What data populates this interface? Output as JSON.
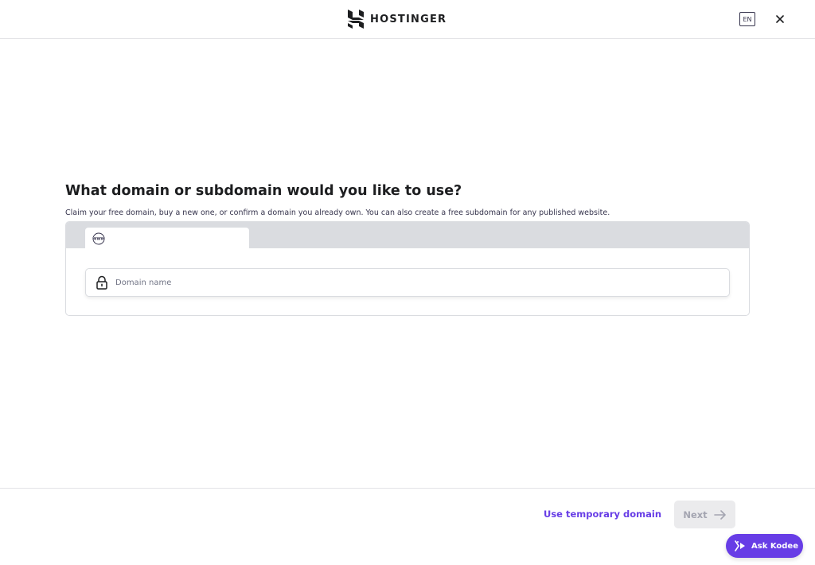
{
  "header": {
    "brand": "HOSTINGER",
    "language": "EN",
    "close_icon": "close-icon"
  },
  "main": {
    "title": "What domain or subdomain would you like to use?",
    "description": "Claim your free domain, buy a new one, or confirm a domain you already own. You can also create a free subdomain for any published website.",
    "tabs": [
      {
        "icon": "www-globe-icon",
        "label": "",
        "active": true
      }
    ],
    "domain_input": {
      "placeholder": "Domain name",
      "value": "",
      "icon": "lock-icon"
    }
  },
  "footer": {
    "temp_domain_label": "Use temporary domain",
    "next_label": "Next",
    "next_icon": "arrow-right-icon"
  },
  "assistant": {
    "label": "Ask Kodee",
    "icon": "kodee-icon"
  },
  "colors": {
    "accent": "#673de6",
    "tab_bar": "#dadce0",
    "disabled_bg": "#ebebed",
    "disabled_text": "#a4a5b1",
    "text_dark": "#1d1e20"
  }
}
